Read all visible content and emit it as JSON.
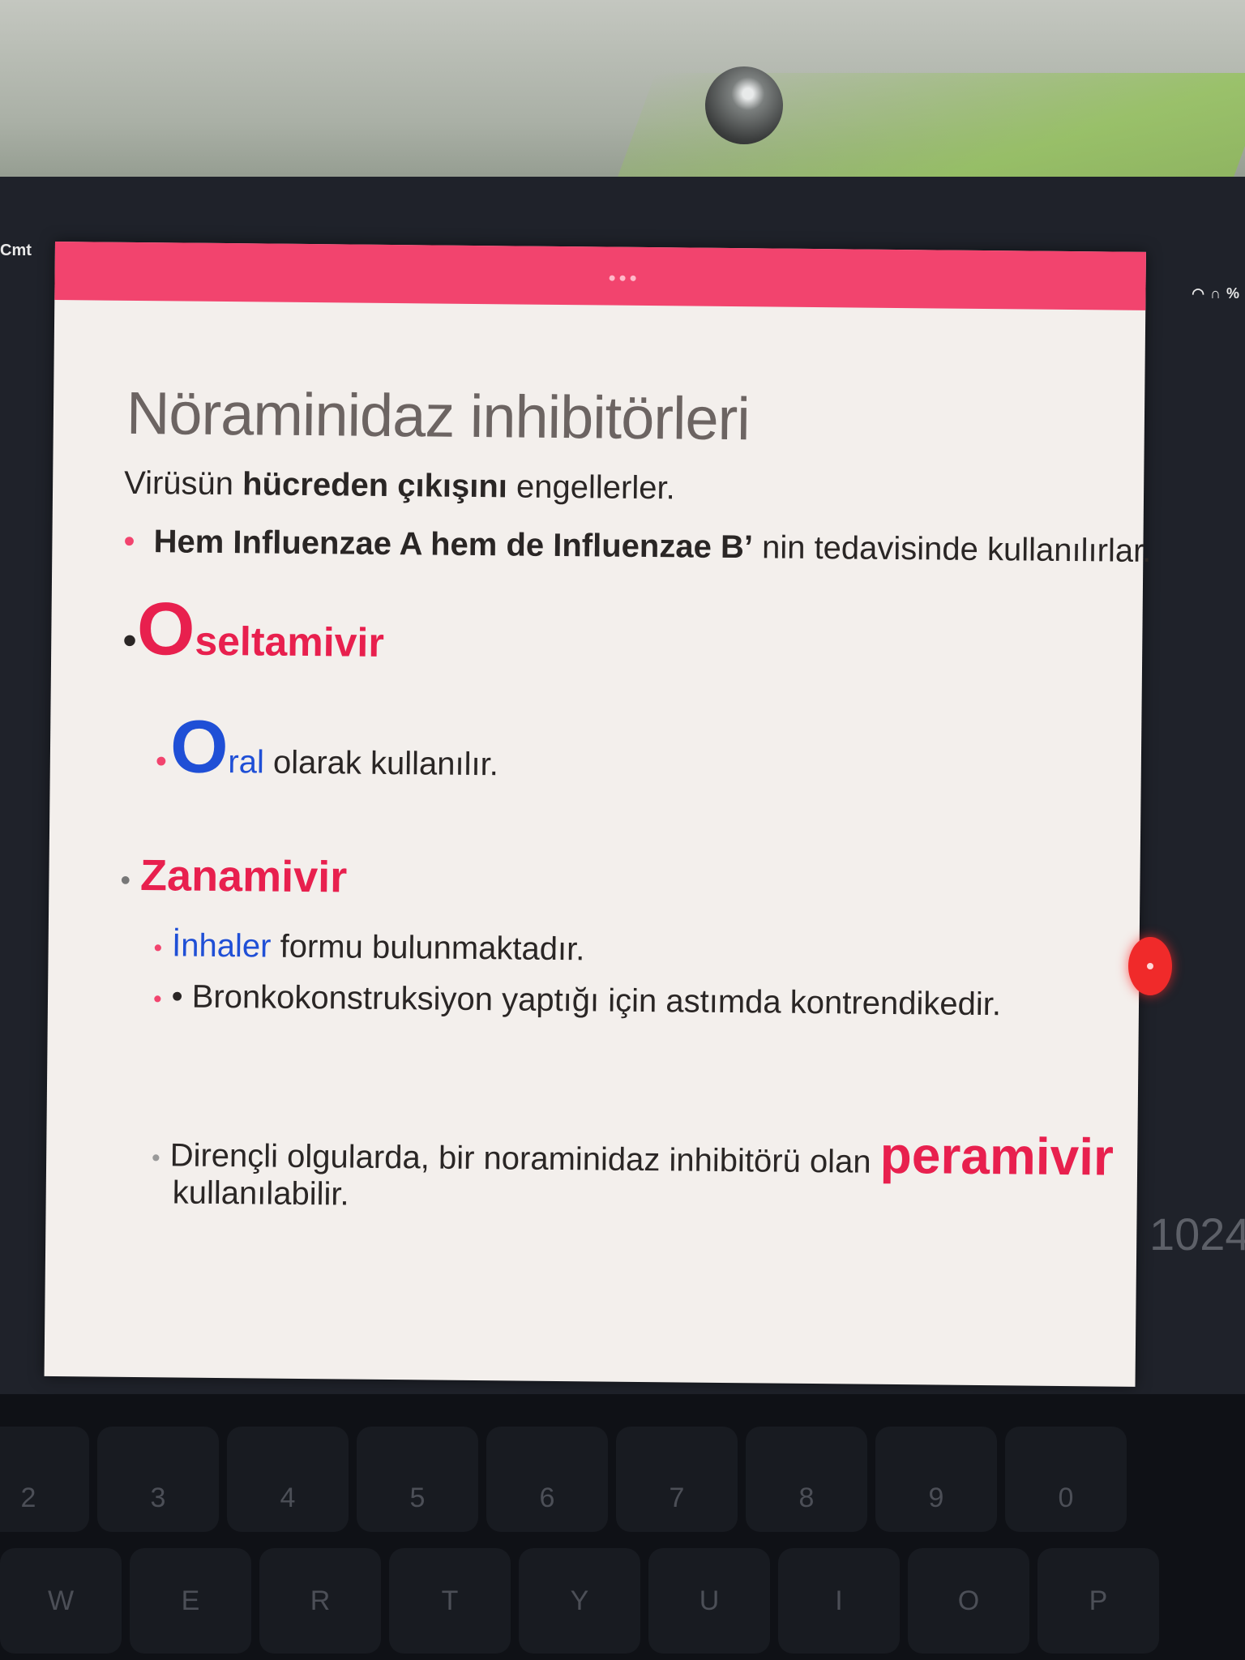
{
  "status": {
    "left_label": "Cmt",
    "right_indicators": "%",
    "side_number": "1024"
  },
  "slide": {
    "title": "Nöraminidaz inhibitörleri",
    "intro": {
      "pre": "Virüsün ",
      "bold": "hücreden çıkışını",
      "post": " engellerler."
    },
    "influenza_line": {
      "bold": "Hem Influenzae A hem de Influenzae B’",
      "post": " nin tedavisinde kullanılırlar."
    },
    "oseltamivir": {
      "initial": "O",
      "rest": "seltamivir",
      "sub": {
        "initial": "O",
        "highlight": "ral",
        "rest": " olarak kullanılır."
      }
    },
    "zanamivir": {
      "heading": "Zanamivir",
      "items": [
        {
          "highlight": "İnhaler",
          "rest": " formu bulunmaktadır."
        },
        {
          "text": "• Bronkokonstruksiyon yaptığı için astımda kontrendikedir."
        }
      ]
    },
    "resistance": {
      "pre": "Dirençli olgularda, bir noraminidaz inhibitörü olan ",
      "highlight": "peramivir",
      "line2": "kullanılabilir."
    }
  },
  "keyboard": {
    "number_row": [
      "2",
      "3",
      "4",
      "5",
      "6",
      "7",
      "8",
      "9",
      "0"
    ],
    "letter_row": [
      "W",
      "E",
      "R",
      "T",
      "Y",
      "U",
      "I",
      "O",
      "P"
    ]
  }
}
